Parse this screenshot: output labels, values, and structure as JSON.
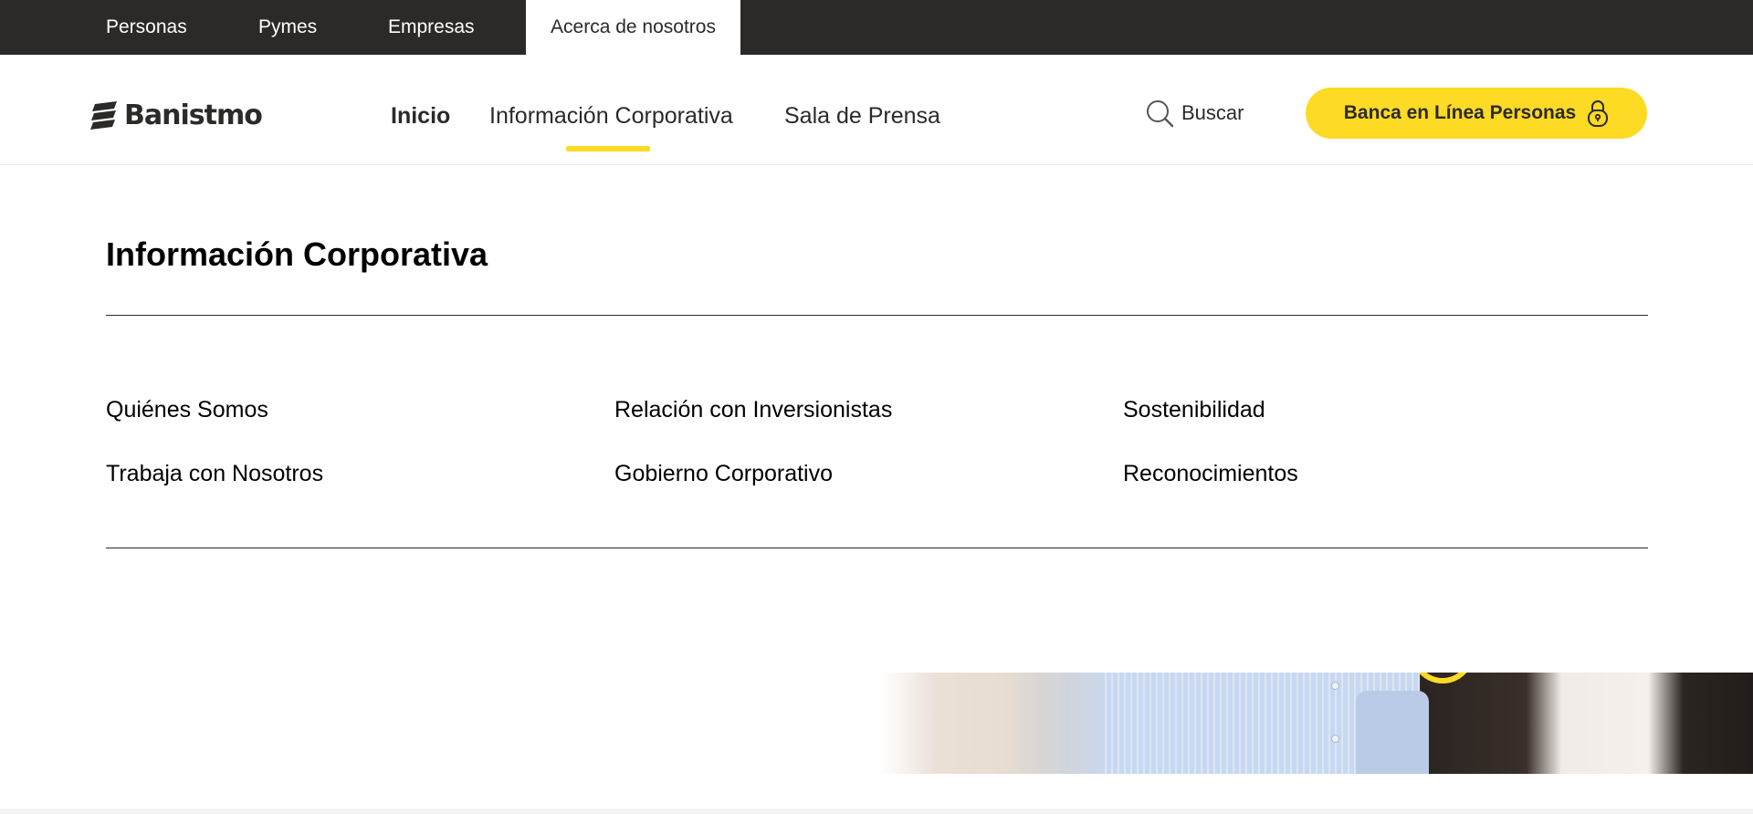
{
  "topbar": {
    "items": [
      {
        "label": "Personas"
      },
      {
        "label": "Pymes"
      },
      {
        "label": "Empresas"
      },
      {
        "label": "Acerca de nosotros",
        "active": true
      }
    ]
  },
  "header": {
    "logo_text": "Banistmo",
    "nav": [
      {
        "label": "Inicio"
      },
      {
        "label": "Información Corporativa",
        "active": true
      },
      {
        "label": "Sala de Prensa"
      }
    ],
    "search_label": "Buscar",
    "cta_label": "Banca en Línea Personas",
    "icons": {
      "search": "search-icon",
      "lock": "lock-icon",
      "logo": "banistmo-logo-icon"
    }
  },
  "menu": {
    "title": "Información Corporativa",
    "columns": [
      [
        "Quiénes Somos",
        "Trabaja con Nosotros"
      ],
      [
        "Relación con Inversionistas",
        "Gobierno Corporativo"
      ],
      [
        "Sostenibilidad",
        "Reconocimientos"
      ]
    ]
  },
  "colors": {
    "brand_yellow": "#fdda24",
    "topbar_bg": "#2c2a29",
    "text_dark": "#2c2a29"
  }
}
